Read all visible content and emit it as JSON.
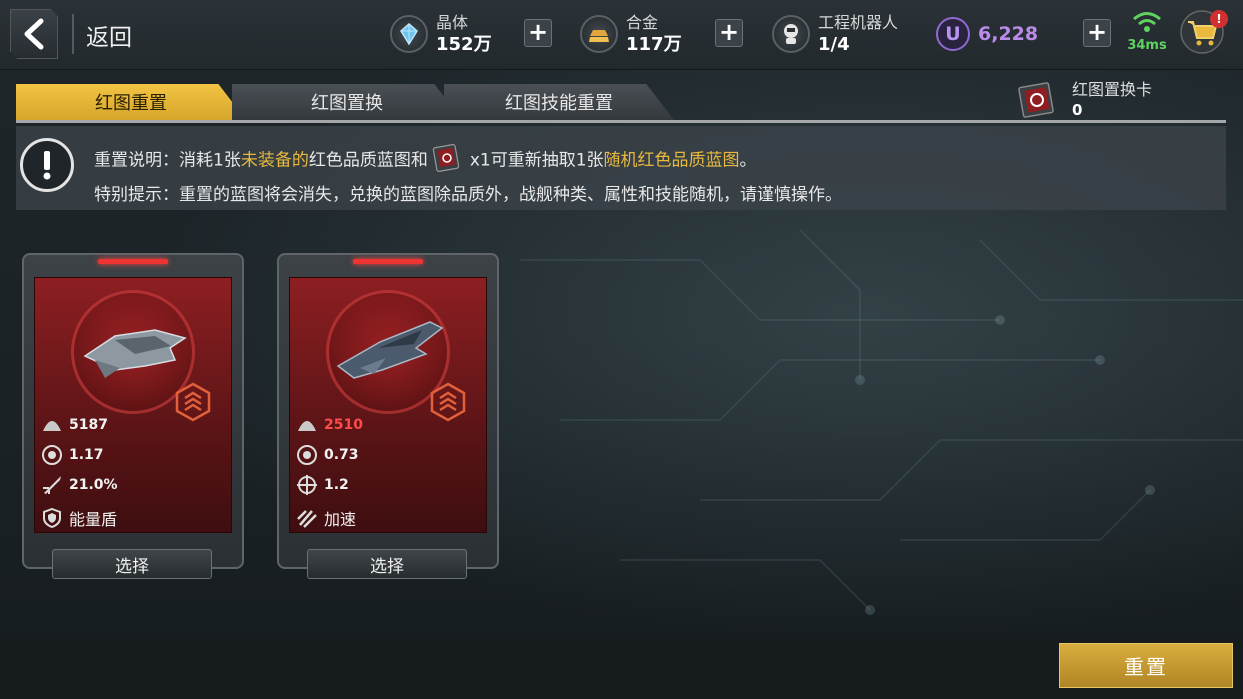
{
  "header": {
    "back_label": "返回",
    "resources": [
      {
        "name": "晶体",
        "value": "152万",
        "icon": "crystal-icon"
      },
      {
        "name": "合金",
        "value": "117万",
        "icon": "alloy-icon"
      },
      {
        "name": "工程机器人",
        "value": "1/4",
        "icon": "robot-icon"
      }
    ],
    "premium_value": "6,228",
    "premium_icon_letter": "U",
    "ping": "34ms",
    "cart_badge": "!"
  },
  "tabs": [
    {
      "label": "红图重置",
      "active": true
    },
    {
      "label": "红图置换",
      "active": false
    },
    {
      "label": "红图技能重置",
      "active": false
    }
  ],
  "swap_card": {
    "name": "红图置换卡",
    "count": "0"
  },
  "info": {
    "line1_a": "重置说明：消耗1张",
    "line1_hl1": "未装备的",
    "line1_b": "红色品质蓝图和",
    "line1_c": "x1可重新抽取1张",
    "line1_hl2": "随机红色品质蓝图",
    "line1_d": "。",
    "line2": "特别提示：重置的蓝图将会消失，兑换的蓝图除品质外，战舰种类、属性和技能随机，请谨慎操作。"
  },
  "cards": [
    {
      "stats": [
        {
          "icon": "armor-icon",
          "value": "5187",
          "red": false
        },
        {
          "icon": "speed-dial-icon",
          "value": "1.17",
          "red": false
        },
        {
          "icon": "missile-icon",
          "value": "21.0%",
          "red": false
        }
      ],
      "skill_icon": "shield-icon",
      "skill": "能量盾",
      "select_label": "选择"
    },
    {
      "stats": [
        {
          "icon": "armor-icon",
          "value": "2510",
          "red": true
        },
        {
          "icon": "speed-dial-icon",
          "value": "0.73",
          "red": false
        },
        {
          "icon": "crosshair-icon",
          "value": "1.2",
          "red": false
        }
      ],
      "skill_icon": "boost-icon",
      "skill": "加速",
      "select_label": "选择"
    }
  ],
  "reset_label": "重置",
  "colors": {
    "accent": "#e8b93d",
    "card_red": "#8d1f22",
    "premium": "#b88ce8"
  }
}
